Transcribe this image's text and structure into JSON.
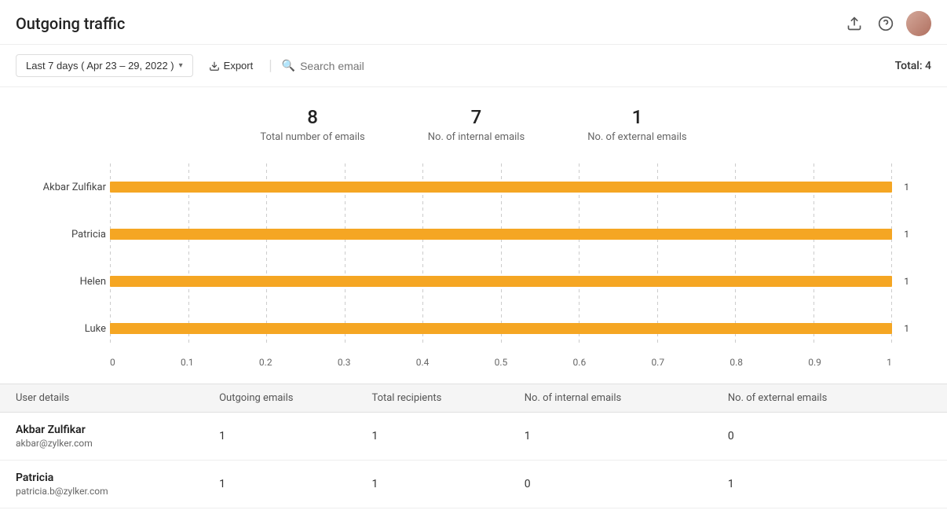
{
  "header": {
    "title": "Outgoing traffic",
    "upload_icon": "↑",
    "help_icon": "?",
    "avatar_alt": "User avatar"
  },
  "toolbar": {
    "date_filter_label": "Last 7 days ( Apr 23 – 29, 2022 )",
    "export_label": "Export",
    "search_placeholder": "Search email",
    "total_label": "Total: 4"
  },
  "stats": [
    {
      "number": "8",
      "label": "Total number of emails"
    },
    {
      "number": "7",
      "label": "No. of internal emails"
    },
    {
      "number": "1",
      "label": "No. of external emails"
    }
  ],
  "chart": {
    "x_axis": [
      "0",
      "0.1",
      "0.2",
      "0.3",
      "0.4",
      "0.5",
      "0.6",
      "0.7",
      "0.8",
      "0.9",
      "1"
    ],
    "bars": [
      {
        "label": "Akbar Zulfikar",
        "value": 1,
        "pct": 100
      },
      {
        "label": "Patricia",
        "value": 1,
        "pct": 100
      },
      {
        "label": "Helen",
        "value": 1,
        "pct": 100
      },
      {
        "label": "Luke",
        "value": 1,
        "pct": 100
      }
    ]
  },
  "table": {
    "headers": [
      "User details",
      "Outgoing emails",
      "Total recipients",
      "No. of internal emails",
      "No. of external emails"
    ],
    "rows": [
      {
        "name": "Akbar Zulfikar",
        "email": "akbar@zylker.com",
        "outgoing": "1",
        "total_recipients": "1",
        "internal": "1",
        "external": "0"
      },
      {
        "name": "Patricia",
        "email": "patricia.b@zylker.com",
        "outgoing": "1",
        "total_recipients": "1",
        "internal": "0",
        "external": "1"
      }
    ]
  }
}
